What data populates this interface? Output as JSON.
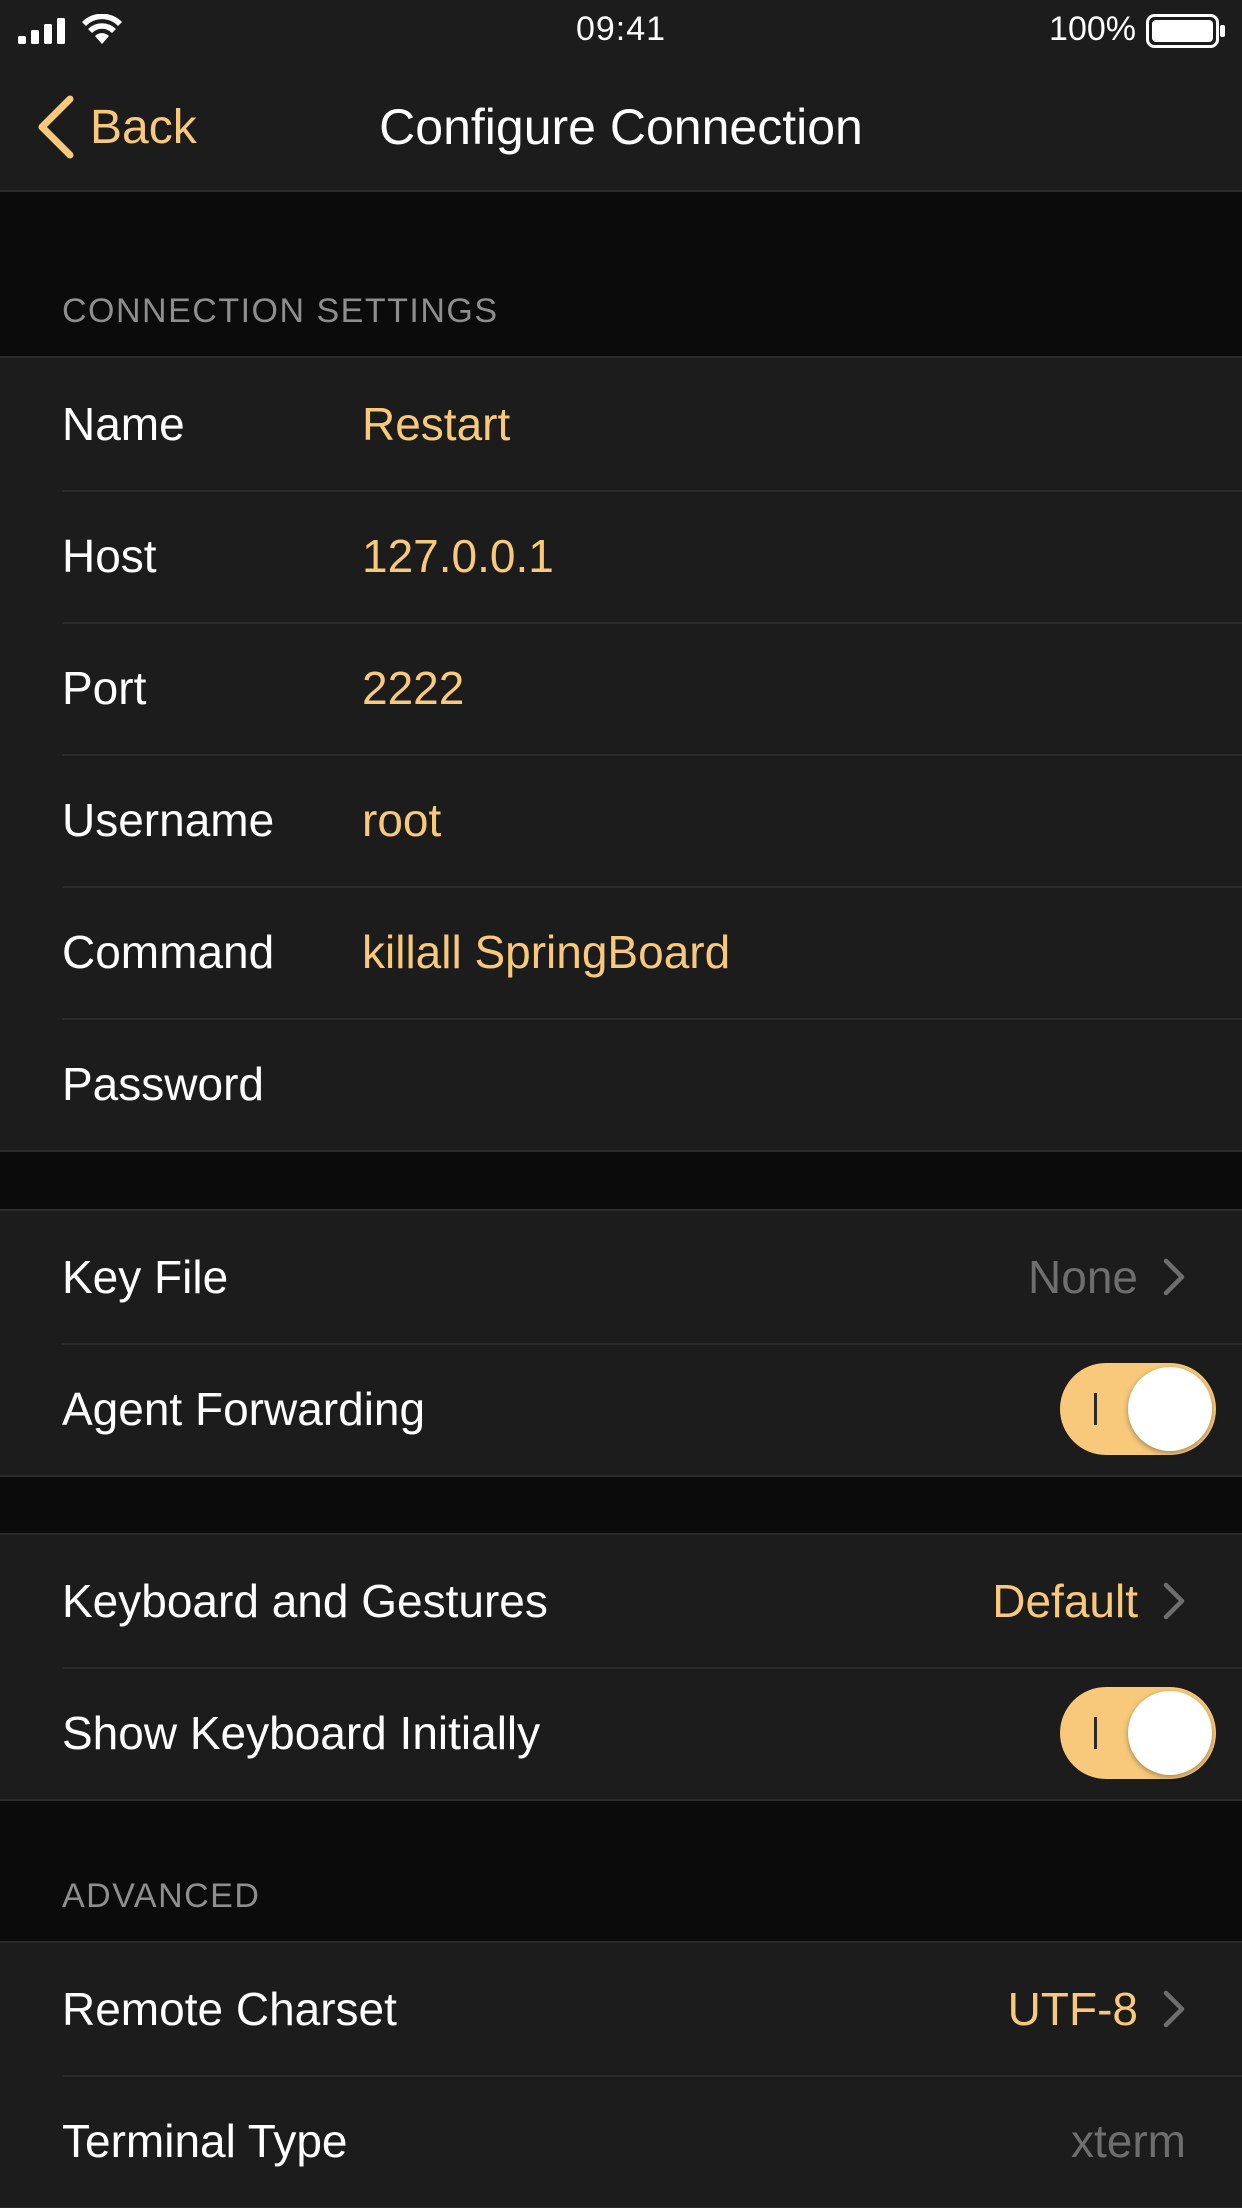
{
  "status": {
    "time": "09:41",
    "battery_text": "100%"
  },
  "nav": {
    "back_label": "Back",
    "title": "Configure Connection"
  },
  "connection": {
    "header": "CONNECTION SETTINGS",
    "rows": [
      {
        "label": "Name",
        "value": "Restart"
      },
      {
        "label": "Host",
        "value": "127.0.0.1"
      },
      {
        "label": "Port",
        "value": "2222"
      },
      {
        "label": "Username",
        "value": "root"
      },
      {
        "label": "Command",
        "value": "killall SpringBoard"
      },
      {
        "label": "Password",
        "value": ""
      }
    ]
  },
  "auth": {
    "key_file_label": "Key File",
    "key_file_value": "None",
    "agent_forwarding_label": "Agent Forwarding",
    "agent_forwarding_on": true
  },
  "keyboard": {
    "gestures_label": "Keyboard and Gestures",
    "gestures_value": "Default",
    "show_keyboard_label": "Show Keyboard Initially",
    "show_keyboard_on": true
  },
  "advanced": {
    "header": "ADVANCED",
    "charset_label": "Remote Charset",
    "charset_value": "UTF-8",
    "terminal_label": "Terminal Type",
    "terminal_placeholder": "xterm"
  },
  "colors": {
    "accent": "#f8c97a",
    "cell_background": "#1c1c1c",
    "page_background": "#0b0b0b",
    "separator": "#2b2b2b",
    "muted_text": "#6e6e6e",
    "header_text": "#8e8e8e"
  },
  "icons": [
    "cellular-signal-icon",
    "wifi-icon",
    "battery-icon",
    "back-chevron-icon",
    "chevron-right-icon"
  ]
}
